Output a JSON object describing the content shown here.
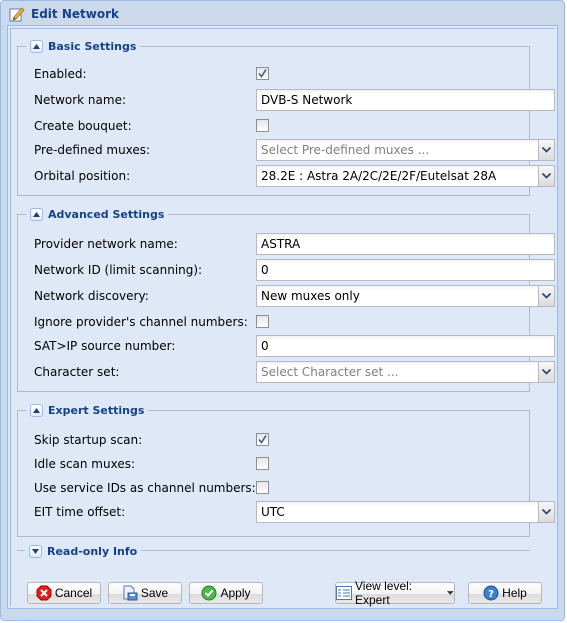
{
  "window": {
    "title": "Edit Network",
    "title_icon": "edit-pencil-icon"
  },
  "sections": {
    "basic": {
      "title": "Basic Settings",
      "expanded": true,
      "fields": {
        "enabled": {
          "label": "Enabled:",
          "checked": true
        },
        "network_name": {
          "label": "Network name:",
          "value": "DVB-S Network"
        },
        "create_bouquet": {
          "label": "Create bouquet:",
          "checked": false
        },
        "predefined_muxes": {
          "label": "Pre-defined muxes:",
          "placeholder": "Select Pre-defined muxes ..."
        },
        "orbital_position": {
          "label": "Orbital position:",
          "value": "28.2E : Astra 2A/2C/2E/2F/Eutelsat 28A"
        }
      }
    },
    "advanced": {
      "title": "Advanced Settings",
      "expanded": true,
      "fields": {
        "provider_network_name": {
          "label": "Provider network name:",
          "value": "ASTRA"
        },
        "network_id": {
          "label": "Network ID (limit scanning):",
          "value": "0"
        },
        "network_discovery": {
          "label": "Network discovery:",
          "value": "New muxes only"
        },
        "ignore_provider_numbers": {
          "label": "Ignore provider's channel numbers:",
          "checked": false
        },
        "satip_source": {
          "label": "SAT>IP source number:",
          "value": "0"
        },
        "character_set": {
          "label": "Character set:",
          "placeholder": "Select Character set ..."
        }
      }
    },
    "expert": {
      "title": "Expert Settings",
      "expanded": true,
      "fields": {
        "skip_startup_scan": {
          "label": "Skip startup scan:",
          "checked": true
        },
        "idle_scan_muxes": {
          "label": "Idle scan muxes:",
          "checked": false
        },
        "service_ids_as_numbers": {
          "label": "Use service IDs as channel numbers:",
          "checked": false
        },
        "eit_time_offset": {
          "label": "EIT time offset:",
          "value": "UTC"
        }
      }
    },
    "readonly": {
      "title": "Read-only Info",
      "expanded": false
    }
  },
  "footer": {
    "cancel": "Cancel",
    "save": "Save",
    "apply": "Apply",
    "view_level": "View level: Expert",
    "help": "Help"
  },
  "colors": {
    "title_text": "#15428b",
    "panel_bg": "#dfe8f6",
    "window_bg": "#cbd9ea",
    "border": "#99bbe8"
  }
}
